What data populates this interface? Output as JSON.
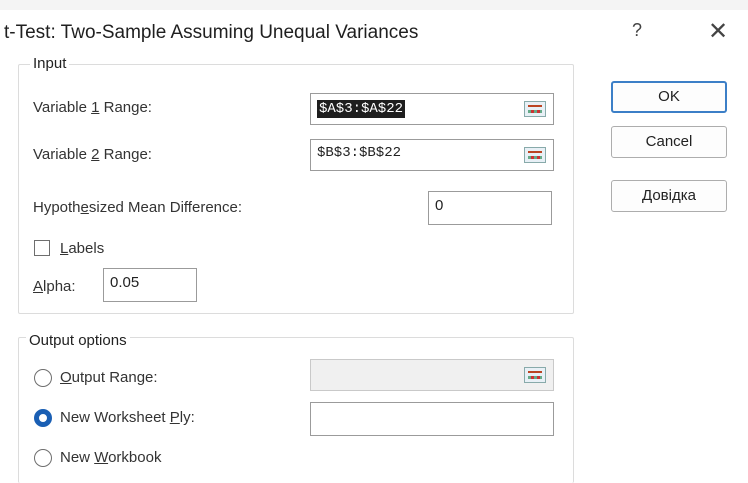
{
  "dialog": {
    "title": "t-Test: Two-Sample Assuming Unequal Variances",
    "help_label": "?",
    "close_label": "✕"
  },
  "input_group": {
    "title": "Input",
    "var1_label_pre": "Variable ",
    "var1_label_key": "1",
    "var1_label_post": " Range:",
    "var1_value": "$A$3:$A$22",
    "var2_label_pre": "Variable ",
    "var2_label_key": "2",
    "var2_label_post": " Range:",
    "var2_value": "$B$3:$B$22",
    "hyp_label_pre": "Hypoth",
    "hyp_label_key": "e",
    "hyp_label_post": "sized Mean Difference:",
    "hyp_value": "0",
    "labels_key": "L",
    "labels_rest": "abels",
    "labels_checked": false,
    "alpha_key": "A",
    "alpha_rest": "lpha:",
    "alpha_value": "0.05"
  },
  "output_group": {
    "title": "Output options",
    "output_range_key": "O",
    "output_range_rest": "utput Range:",
    "output_range_value": "",
    "new_ply_pre": "New Worksheet ",
    "new_ply_key": "P",
    "new_ply_post": "ly:",
    "new_ply_value": "",
    "new_workbook_pre": "New ",
    "new_workbook_key": "W",
    "new_workbook_post": "orkbook",
    "selected_option": "new_worksheet_ply"
  },
  "buttons": {
    "ok": "OK",
    "cancel": "Cancel",
    "help_key": "Д",
    "help_rest": "овідка"
  },
  "colors": {
    "accent": "#1a5fb4",
    "default_button_border": "#3c7fc7"
  }
}
